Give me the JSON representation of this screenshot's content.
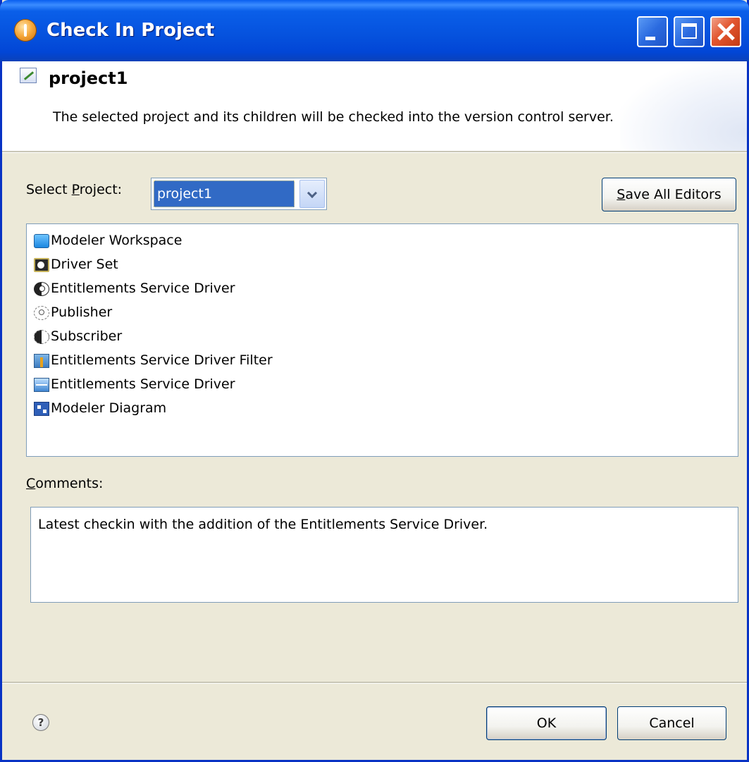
{
  "window": {
    "title": "Check In Project"
  },
  "header": {
    "title": "project1",
    "description": "The selected project and its children will be checked into the version control server."
  },
  "select_project": {
    "label": "Select Project:",
    "label_mnemonic": "P",
    "value": "project1"
  },
  "save_all_editors": {
    "label": "Save All Editors",
    "mnemonic": "S"
  },
  "tree": {
    "items": [
      {
        "label": "Modeler Workspace",
        "icon": "workspace-icon"
      },
      {
        "label": "Driver Set",
        "icon": "driver-set-icon"
      },
      {
        "label": "Entitlements Service Driver",
        "icon": "yin-yang-icon"
      },
      {
        "label": "Publisher",
        "icon": "publisher-icon"
      },
      {
        "label": "Subscriber",
        "icon": "subscriber-icon"
      },
      {
        "label": "Entitlements Service Driver Filter",
        "icon": "filter-icon"
      },
      {
        "label": "Entitlements Service Driver",
        "icon": "driver-icon"
      },
      {
        "label": "Modeler Diagram",
        "icon": "diagram-icon"
      }
    ]
  },
  "comments": {
    "label": "Comments:",
    "mnemonic": "C",
    "value": "Latest checkin with the addition of the Entitlements Service Driver."
  },
  "footer": {
    "help_symbol": "?",
    "ok_label": "OK",
    "cancel_label": "Cancel"
  },
  "colors": {
    "titlebar": "#0551dd",
    "selection": "#316ac5",
    "dialog_background": "#ece9d8",
    "close_button": "#e2562f"
  }
}
